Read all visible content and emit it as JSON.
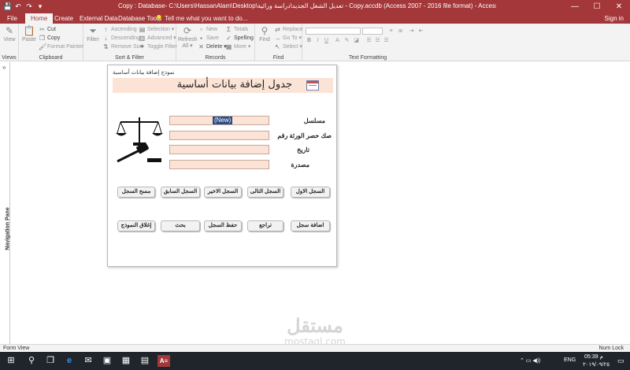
{
  "window": {
    "title": "Copy : Database- C:\\Users\\HassanAlam\\Desktop\\تعديل الشغل الجديد\\دراسة ورائية - Copy.accdb (Access 2007 - 2016 file format) - Access",
    "minimize": "—",
    "restore": "☐",
    "close": "✕"
  },
  "qat": {
    "save": "💾",
    "undo": "↶",
    "redo": "↷",
    "more": "▾"
  },
  "ribbon_tabs": [
    {
      "label": "File"
    },
    {
      "label": "Home"
    },
    {
      "label": "Create"
    },
    {
      "label": "External Data"
    },
    {
      "label": "Database Tools"
    }
  ],
  "tell_me": "💡 Tell me what you want to do...",
  "sign_in": "Sign in",
  "ribbon": {
    "views": {
      "view": "View",
      "label": "Views"
    },
    "clipboard": {
      "paste": "Paste",
      "cut": "Cut",
      "copy": "Copy",
      "format_painter": "Format Painter",
      "label": "Clipboard"
    },
    "sort_filter": {
      "filter": "Filter",
      "ascending": "Ascending",
      "descending": "Descending",
      "remove_sort": "Remove Sort",
      "selection": "Selection ▾",
      "advanced": "Advanced ▾",
      "toggle_filter": "Toggle Filter",
      "label": "Sort & Filter"
    },
    "records": {
      "refresh": "Refresh",
      "refresh2": "All ▾",
      "new": "New",
      "save": "Save",
      "delete": "Delete ▾",
      "totals": "Totals",
      "spelling": "Spelling",
      "more": "More ▾",
      "label": "Records"
    },
    "find": {
      "find": "Find",
      "replace": "Replace",
      "goto": "Go To ▾",
      "select": "Select ▾",
      "label": "Find"
    },
    "text_formatting": {
      "label": "Text Formatting"
    }
  },
  "nav_pane": {
    "label": "Navigation Pane",
    "toggle": "»"
  },
  "form": {
    "caption": "نموذج إضافة بيانات أساسية",
    "title": "جدول إضافة بيانات أساسية",
    "fields": [
      {
        "label": "مسلسل",
        "value": "(New)"
      },
      {
        "label": "صك حصر الورثة رقم",
        "value": ""
      },
      {
        "label": "تاريخ",
        "value": ""
      },
      {
        "label": "مصدرة",
        "value": ""
      }
    ],
    "buttons_row1": [
      "السجل الاول",
      "السجل التالى",
      "السجل الاخير",
      "السجل السابق",
      "مسح السجل"
    ],
    "buttons_row2": [
      "اضافة سجل",
      "تراجع",
      "حفظ السجل",
      "بحث",
      "إغلاق النموذج"
    ]
  },
  "status": {
    "left": "Form View",
    "right": "Num Lock"
  },
  "taskbar": {
    "start": "⊞",
    "search": "⚲",
    "task_view": "❐",
    "edge": "e",
    "mail": "✉",
    "photos": "▣",
    "calc": "▦",
    "access": "A≡",
    "tray_icons": "⌃  ▭  ◀))  ",
    "lang": "ENG",
    "time": "05:39 م",
    "date": "٢٠١٩/٠٩/٢٥",
    "notif": "▭"
  },
  "watermark": {
    "arabic": "مستقل",
    "latin": "mostaql.com"
  }
}
